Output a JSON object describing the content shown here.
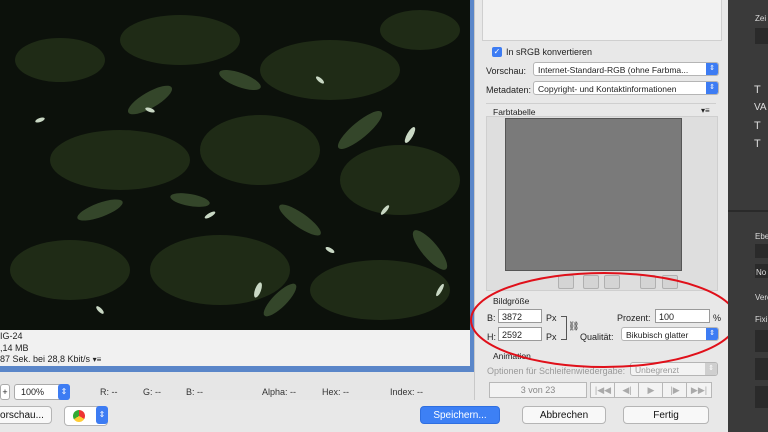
{
  "image_info": {
    "format_line": "IG-24",
    "size_line": ",14 MB",
    "time_line": "87 Sek. bei 28,8 Kbit/s"
  },
  "options": {
    "srgb_label": "In sRGB konvertieren",
    "srgb_checked": true,
    "vorschau_label": "Vorschau:",
    "vorschau_value": "Internet-Standard-RGB (ohne Farbma...",
    "metadaten_label": "Metadaten:",
    "metadaten_value": "Copyright- und Kontaktinformationen"
  },
  "color_table": {
    "title": "Farbtabelle",
    "swatch_color": "#7a7a7a"
  },
  "image_size": {
    "title": "Bildgröße",
    "width_label": "B:",
    "width_value": "3872",
    "height_label": "H:",
    "height_value": "2592",
    "unit": "Px",
    "percent_label": "Prozent:",
    "percent_value": "100",
    "percent_unit": "%",
    "quality_label": "Qualität:",
    "quality_value": "Bikubisch glatter"
  },
  "animation": {
    "title": "Animation",
    "loop_label": "Optionen für Schleifenwiedergabe:",
    "loop_value": "Unbegrenzt",
    "frame_counter": "3 von 23"
  },
  "status": {
    "zoom": "100%",
    "r": "R: --",
    "g": "G: --",
    "b": "B: --",
    "alpha": "Alpha: --",
    "hex": "Hex: --",
    "index": "Index: --"
  },
  "buttons": {
    "preview": "orschau...",
    "save": "Speichern...",
    "cancel": "Abbrechen",
    "done": "Fertig"
  },
  "dark_panel": {
    "zei": "Zei",
    "ebe": "Ebe",
    "no": "No",
    "vere": "Vere",
    "fixi": "Fixi"
  },
  "colors": {
    "accent": "#3d7cf3",
    "annotation": "#e0101a"
  }
}
